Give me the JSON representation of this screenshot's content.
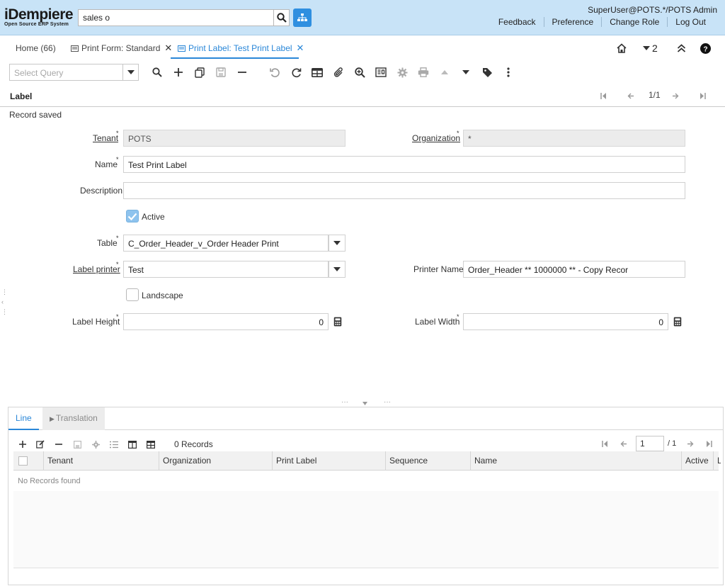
{
  "header": {
    "logo_main": "iDempiere",
    "logo_sub": "Open Source ERP System",
    "search_value": "sales o",
    "user": "SuperUser@POTS.*/POTS Admin",
    "links": [
      "Feedback",
      "Preference",
      "Change Role",
      "Log Out"
    ]
  },
  "tabs": [
    {
      "label": "Home (66)"
    },
    {
      "label": "Print Form: Standard"
    },
    {
      "label": "Print Label: Test Print Label"
    }
  ],
  "window_count": "2",
  "toolbar": {
    "query_placeholder": "Select Query"
  },
  "panel": {
    "title": "Label",
    "record_nav": "1/1",
    "status": "Record saved"
  },
  "form": {
    "tenant_label": "Tenant",
    "tenant_value": "POTS",
    "org_label": "Organization",
    "org_value": "*",
    "name_label": "Name",
    "name_value": "Test Print Label",
    "description_label": "Description",
    "description_value": "",
    "active_label": "Active",
    "table_label": "Table",
    "table_value": "C_Order_Header_v_Order Header Print",
    "printer_label": "Label printer",
    "printer_value": "Test",
    "printer_name_label": "Printer Name",
    "printer_name_value": "Order_Header  ** 1000000 ** - Copy Recor",
    "landscape_label": "Landscape",
    "height_label": "Label Height",
    "height_value": "0",
    "width_label": "Label Width",
    "width_value": "0"
  },
  "detail": {
    "tabs": [
      "Line",
      "Translation"
    ],
    "records": "0 Records",
    "page_value": "1",
    "page_total": "/ 1",
    "columns": [
      "Tenant",
      "Organization",
      "Print Label",
      "Sequence",
      "Name",
      "Active",
      "L"
    ],
    "empty_text": "No Records found"
  },
  "colors": {
    "accent": "#2a87d8",
    "header_bg": "#c8e3f7"
  }
}
